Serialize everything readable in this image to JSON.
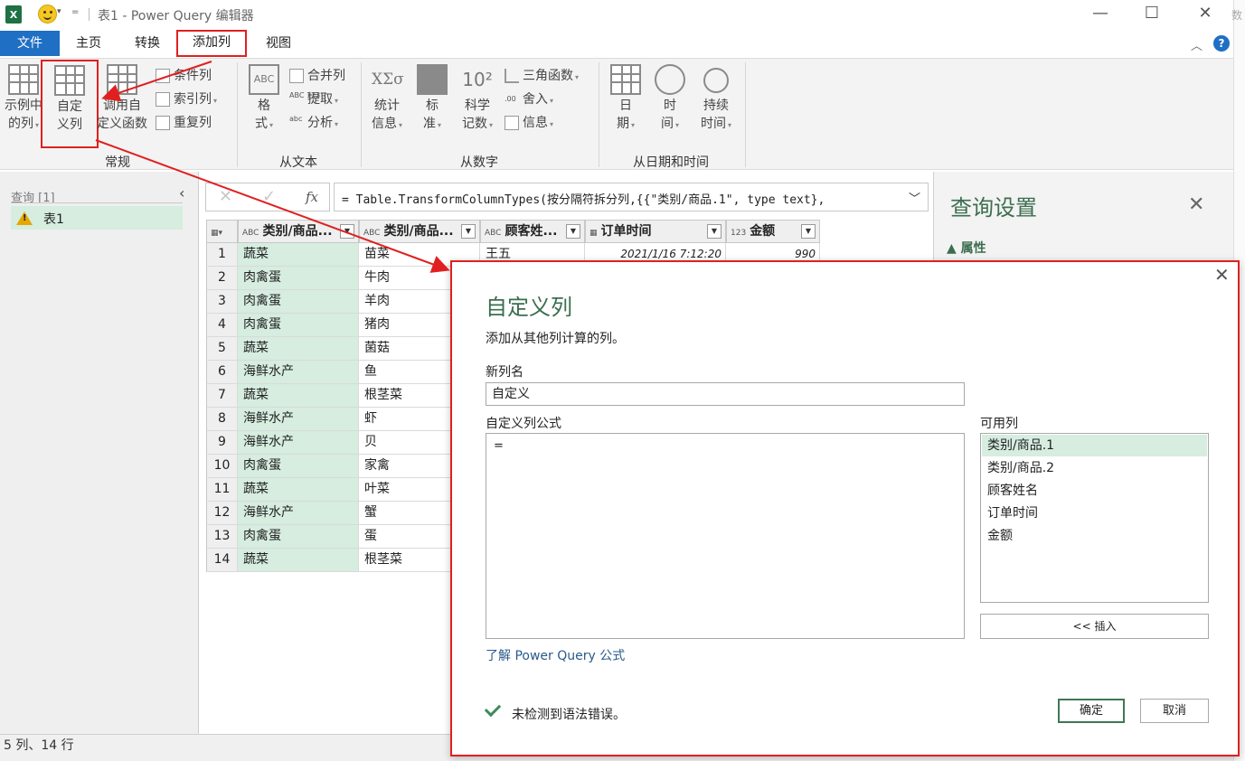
{
  "titlebar": {
    "app_icon": "X",
    "window_title": "表1 - Power Query 编辑器",
    "qat_dropdown": "▾",
    "qat_customize": "=",
    "minimize": "—",
    "maximize": "☐",
    "close": "✕",
    "edge_text": "数"
  },
  "tabs": {
    "file": "文件",
    "home": "主页",
    "transform": "转换",
    "add_column": "添加列",
    "view": "视图",
    "help": "?"
  },
  "ribbon": {
    "general": {
      "label": "常规",
      "column_from_examples": [
        "示例中",
        "的列"
      ],
      "custom_column": [
        "自定",
        "义列"
      ],
      "invoke_custom_function": [
        "调用自",
        "定义函数"
      ],
      "conditional_column": "条件列",
      "index_column": "索引列",
      "duplicate_column": "重复列"
    },
    "from_text": {
      "label": "从文本",
      "format": [
        "格",
        "式"
      ],
      "merge_columns": "合并列",
      "extract": "提取",
      "parse": "分析"
    },
    "from_number": {
      "label": "从数字",
      "statistics": [
        "统计",
        "信息"
      ],
      "standard": [
        "标",
        "准"
      ],
      "scientific": [
        "科学",
        "记数"
      ],
      "sci_glyph": "10²",
      "stat_glyph": "XΣσ",
      "trigonometry": "三角函数",
      "rounding": "舍入",
      "information": "信息"
    },
    "from_datetime": {
      "label": "从日期和时间",
      "date": [
        "日",
        "期"
      ],
      "time": [
        "时",
        "间"
      ],
      "duration": [
        "持续",
        "时间"
      ]
    }
  },
  "left_pane": {
    "title": "查询 [1]",
    "collapse": "‹",
    "query": "表1"
  },
  "formula_bar": {
    "cancel": "✕",
    "confirm": "✓",
    "fx": "fx",
    "formula": "= Table.TransformColumnTypes(按分隔符拆分列,{{\"类别/商品.1\", type text},",
    "expand": "❯"
  },
  "grid": {
    "columns": [
      {
        "type": "ABC",
        "name": "类别/商品..."
      },
      {
        "type": "ABC",
        "name": "类别/商品..."
      },
      {
        "type": "ABC",
        "name": "顾客姓..."
      },
      {
        "type": "date",
        "name": "订单时间"
      },
      {
        "type": "123",
        "name": "金额"
      }
    ],
    "row1_extra": {
      "customer": "王五",
      "time": "2021/1/16 7:12:20",
      "amount": "990"
    },
    "rows": [
      {
        "n": "1",
        "c1": "蔬菜",
        "c2": "苗菜"
      },
      {
        "n": "2",
        "c1": "肉禽蛋",
        "c2": "牛肉"
      },
      {
        "n": "3",
        "c1": "肉禽蛋",
        "c2": "羊肉"
      },
      {
        "n": "4",
        "c1": "肉禽蛋",
        "c2": "猪肉"
      },
      {
        "n": "5",
        "c1": "蔬菜",
        "c2": "菌菇"
      },
      {
        "n": "6",
        "c1": "海鲜水产",
        "c2": "鱼"
      },
      {
        "n": "7",
        "c1": "蔬菜",
        "c2": "根茎菜"
      },
      {
        "n": "8",
        "c1": "海鲜水产",
        "c2": "虾"
      },
      {
        "n": "9",
        "c1": "海鲜水产",
        "c2": "贝"
      },
      {
        "n": "10",
        "c1": "肉禽蛋",
        "c2": "家禽"
      },
      {
        "n": "11",
        "c1": "蔬菜",
        "c2": "叶菜"
      },
      {
        "n": "12",
        "c1": "海鲜水产",
        "c2": "蟹"
      },
      {
        "n": "13",
        "c1": "肉禽蛋",
        "c2": "蛋"
      },
      {
        "n": "14",
        "c1": "蔬菜",
        "c2": "根茎菜"
      }
    ]
  },
  "right_pane": {
    "title": "查询设置",
    "close": "✕",
    "properties": "▲ 属性"
  },
  "status_bar": {
    "text": "5 列、14 行"
  },
  "dialog": {
    "close": "✕",
    "title": "自定义列",
    "description": "添加从其他列计算的列。",
    "new_column_label": "新列名",
    "new_column_value": "自定义",
    "formula_label": "自定义列公式",
    "formula_value": "=",
    "available_label": "可用列",
    "available_columns": [
      "类别/商品.1",
      "类别/商品.2",
      "顾客姓名",
      "订单时间",
      "金额"
    ],
    "insert": "<< 插入",
    "learn_link": "了解 Power Query 公式",
    "status": "未检测到语法错误。",
    "ok": "确定",
    "cancel": "取消"
  },
  "colors": {
    "accent_red": "#e02020",
    "selection_green": "#d6ede0",
    "title_green": "#3b6e4f",
    "file_tab_blue": "#1f6fc4"
  }
}
